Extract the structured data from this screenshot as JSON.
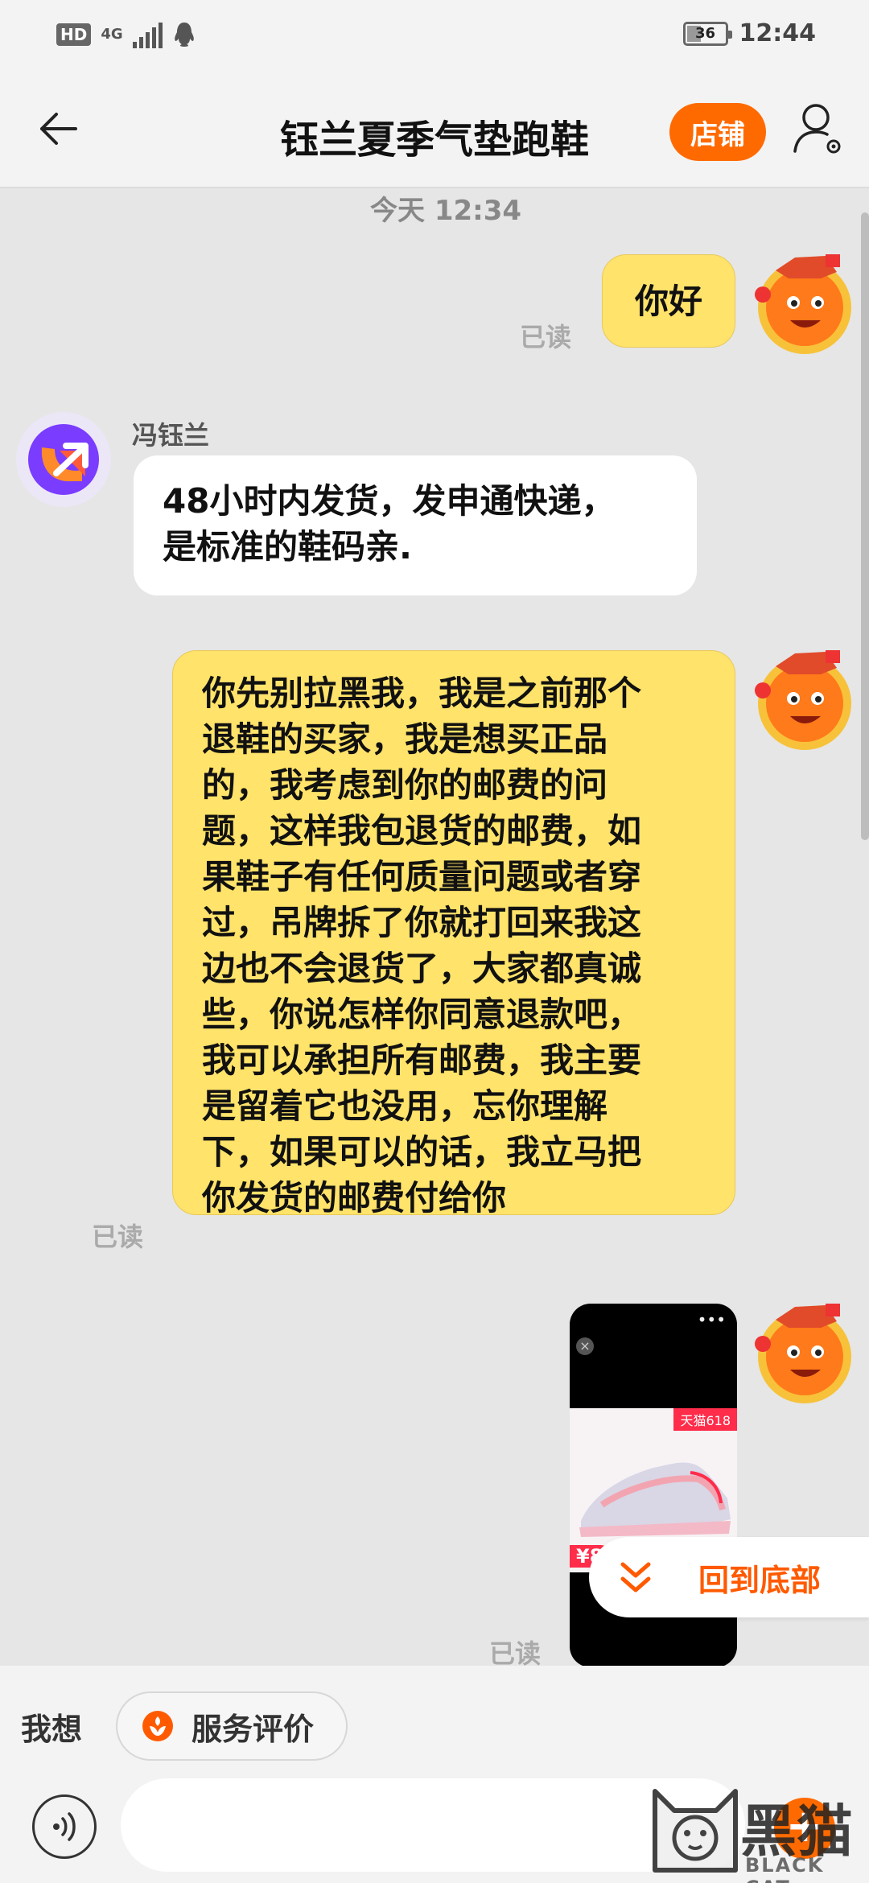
{
  "status_bar": {
    "hd": "HD",
    "network": "4G",
    "battery": "36",
    "time": "12:44"
  },
  "header": {
    "title": "钰兰夏季气垫跑鞋",
    "shop_label": "店铺"
  },
  "chat": {
    "timestamp": "今天 12:34",
    "messages": [
      {
        "side": "right",
        "text": "你好",
        "status": "已读"
      },
      {
        "side": "left",
        "sender": "冯钰兰",
        "lines": [
          "48小时内发货，发申通快递，",
          "是标准的鞋码亲."
        ]
      },
      {
        "side": "right",
        "lines": [
          "你先别拉黑我，我是之前那个",
          "退鞋的买家，我是想买正品",
          "的，我考虑到你的邮费的问",
          "题，这样我包退货的邮费，如",
          "果鞋子有任何质量问题或者穿",
          "过，吊牌拆了你就打回来我这",
          "边也不会退货了，大家都真诚",
          "些，你说怎样你同意退款吧，",
          "我可以承担所有邮费，我主要",
          "是留着它也没用，忘你理解",
          "下，如果可以的话，我立马把",
          "你发货的邮费付给你"
        ],
        "status": "已读"
      },
      {
        "side": "right",
        "type": "media",
        "tag": "天猫618",
        "price": "¥8",
        "status": "已读"
      }
    ],
    "back_to_bottom": "回到底部"
  },
  "quick_bar": {
    "label": "我想",
    "chip": "服务评价"
  },
  "input": {
    "placeholder": ""
  },
  "watermark": {
    "cn": "黑猫",
    "en": "BLACK CAT"
  },
  "colors": {
    "accent": "#ff6a00",
    "bubble_self": "#ffe36a",
    "background": "#e6e6e6"
  }
}
